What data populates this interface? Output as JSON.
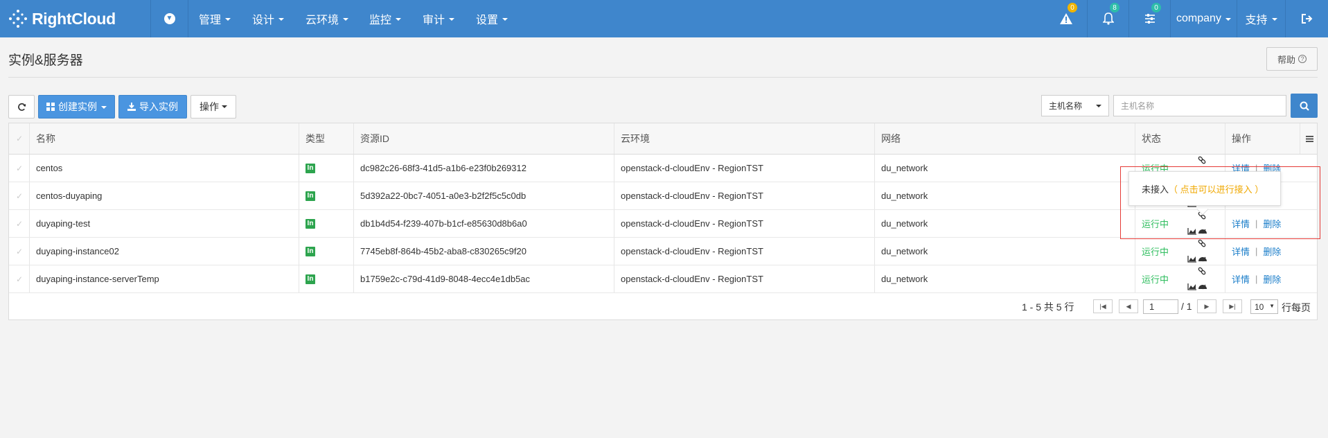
{
  "brand": {
    "name": "RightCloud"
  },
  "nav": {
    "items": [
      {
        "label": "管理"
      },
      {
        "label": "设计"
      },
      {
        "label": "云环境"
      },
      {
        "label": "监控"
      },
      {
        "label": "审计"
      },
      {
        "label": "设置"
      }
    ],
    "alerts_count": "0",
    "notifications_count": "8",
    "tasks_count": "0",
    "user": "company",
    "support": "支持"
  },
  "page": {
    "title": "实例&服务器",
    "help_label": "帮助"
  },
  "toolbar": {
    "create_label": "创建实例",
    "import_label": "导入实例",
    "actions_label": "操作",
    "search_field_selected": "主机名称",
    "search_placeholder": "主机名称"
  },
  "table": {
    "columns": [
      "名称",
      "类型",
      "资源ID",
      "云环境",
      "网络",
      "状态",
      "操作"
    ],
    "rows": [
      {
        "name": "centos",
        "type_icon": "In",
        "resource_id": "dc982c26-68f3-41d5-a1b6-e23f0b269312",
        "cloud_env": "openstack-d-cloudEnv - RegionTST",
        "network": "du_network",
        "status": "运行中",
        "detail": "详情",
        "delete": "删除"
      },
      {
        "name": "centos-duyaping",
        "type_icon": "In",
        "resource_id": "5d392a22-0bc7-4051-a0e3-b2f2f5c5c0db",
        "cloud_env": "openstack-d-cloudEnv - RegionTST",
        "network": "du_network",
        "status": "",
        "detail": "",
        "delete": ""
      },
      {
        "name": "duyaping-test",
        "type_icon": "In",
        "resource_id": "db1b4d54-f239-407b-b1cf-e85630d8b6a0",
        "cloud_env": "openstack-d-cloudEnv - RegionTST",
        "network": "du_network",
        "status": "运行中",
        "detail": "详情",
        "delete": "删除"
      },
      {
        "name": "duyaping-instance02",
        "type_icon": "In",
        "resource_id": "7745eb8f-864b-45b2-aba8-c830265c9f20",
        "cloud_env": "openstack-d-cloudEnv - RegionTST",
        "network": "du_network",
        "status": "运行中",
        "detail": "详情",
        "delete": "删除"
      },
      {
        "name": "duyaping-instance-serverTemp",
        "type_icon": "In",
        "resource_id": "b1759e2c-c79d-41d9-8048-4ecc4e1db5ac",
        "cloud_env": "openstack-d-cloudEnv - RegionTST",
        "network": "du_network",
        "status": "运行中",
        "detail": "详情",
        "delete": "删除"
      }
    ]
  },
  "pagination": {
    "summary": "1 - 5 共 5 行",
    "current_page": "1",
    "total_pages": "/ 1",
    "page_size": "10",
    "per_page_label": "行每页"
  },
  "popover": {
    "text": "未接入",
    "hint": "（ 点击可以进行接入 ）",
    "hint_color": "#f0a800"
  },
  "colors": {
    "nav_bg": "#3f86cc",
    "accent": "#4a95e0",
    "status_ok": "#2ebd5e",
    "link": "#1a7dc9",
    "highlight_box": "#e53935"
  },
  "icons": {
    "refresh": "refresh-icon",
    "grid": "grid-icon",
    "download": "download-icon",
    "search": "search-icon",
    "warning": "warning-icon",
    "bell": "bell-icon",
    "sliders": "sliders-icon",
    "logout": "logout-icon",
    "link_broken": "link-icon",
    "chart": "chart-icon",
    "gauge": "gauge-icon"
  }
}
